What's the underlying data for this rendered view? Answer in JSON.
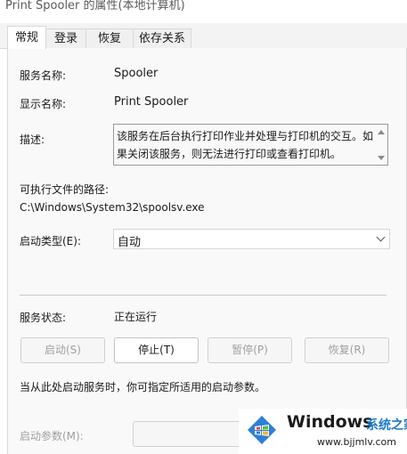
{
  "window": {
    "title": "Print Spooler 的属性(本地计算机)"
  },
  "tabs": [
    {
      "label": "常规",
      "active": true
    },
    {
      "label": "登录",
      "active": false
    },
    {
      "label": "恢复",
      "active": false
    },
    {
      "label": "依存关系",
      "active": false
    }
  ],
  "general": {
    "service_name_label": "服务名称:",
    "service_name": "Spooler",
    "display_name_label": "显示名称:",
    "display_name": "Print Spooler",
    "description_label": "描述:",
    "description": "该服务在后台执行打印作业并处理与打印机的交互。如果关闭该服务，则无法进行打印或查看打印机。",
    "path_label": "可执行文件的路径:",
    "path": "C:\\Windows\\System32\\spoolsv.exe",
    "startup_type_label": "启动类型(E):",
    "startup_type": "自动",
    "status_label": "服务状态:",
    "status": "正在运行",
    "buttons": {
      "start": "启动(S)",
      "stop": "停止(T)",
      "pause": "暂停(P)",
      "resume": "恢复(R)"
    },
    "hint": "当从此处启动服务时，你可指定所适用的启动参数。",
    "start_params_label": "启动参数(M):",
    "start_params_value": ""
  },
  "watermark": {
    "brand": "Windows",
    "brand_cn": "系统之家",
    "url": "www.bjjmlv.com"
  }
}
